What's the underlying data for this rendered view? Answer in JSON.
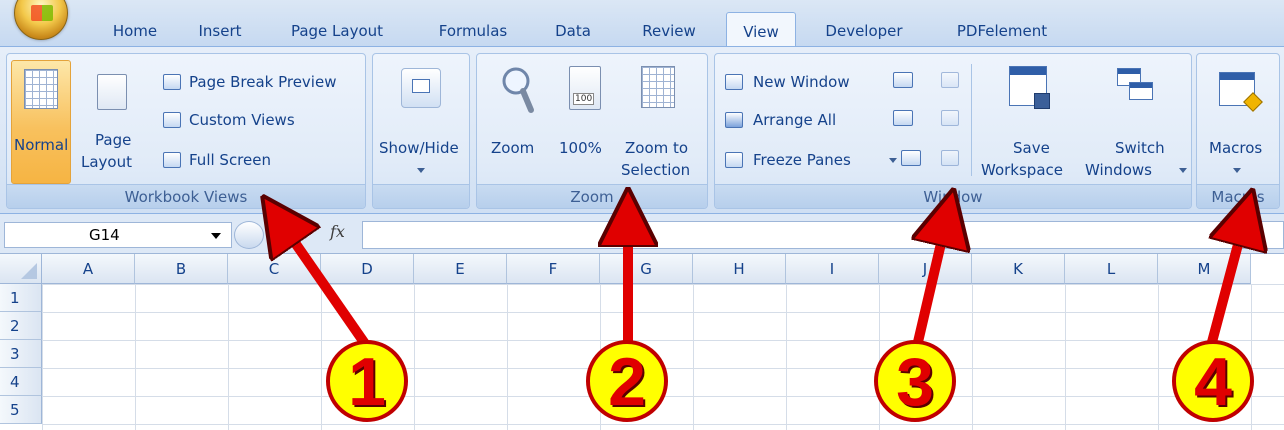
{
  "tabs": [
    {
      "label": "Home",
      "active": false
    },
    {
      "label": "Insert",
      "active": false
    },
    {
      "label": "Page Layout",
      "active": false
    },
    {
      "label": "Formulas",
      "active": false
    },
    {
      "label": "Data",
      "active": false
    },
    {
      "label": "Review",
      "active": false
    },
    {
      "label": "View",
      "active": true
    },
    {
      "label": "Developer",
      "active": false
    },
    {
      "label": "PDFelement",
      "active": false
    }
  ],
  "groups": {
    "workbook_views": {
      "title": "Workbook Views",
      "normal": "Normal",
      "page_layout_1": "Page",
      "page_layout_2": "Layout",
      "page_break_preview": "Page Break Preview",
      "custom_views": "Custom Views",
      "full_screen": "Full Screen"
    },
    "show_hide": {
      "title": "",
      "label": "Show/Hide"
    },
    "zoom": {
      "title": "Zoom",
      "zoom": "Zoom",
      "hundred": "100%",
      "hundred_icon": "100",
      "zoom_to_1": "Zoom to",
      "zoom_to_2": "Selection"
    },
    "window": {
      "title": "Window",
      "new_window": "New Window",
      "arrange_all": "Arrange All",
      "freeze_panes": "Freeze Panes",
      "save_1": "Save",
      "save_2": "Workspace",
      "switch_1": "Switch",
      "switch_2": "Windows"
    },
    "macros": {
      "title": "Macros",
      "label": "Macros"
    }
  },
  "formula_bar": {
    "name_box": "G14",
    "fx": "fx",
    "formula": ""
  },
  "sheet": {
    "columns": [
      "A",
      "B",
      "C",
      "D",
      "E",
      "F",
      "G",
      "H",
      "I",
      "J",
      "K",
      "L",
      "M"
    ],
    "rows": [
      "1",
      "2",
      "3",
      "4",
      "5"
    ]
  },
  "annotations": [
    "1",
    "2",
    "3",
    "4"
  ],
  "colors": {
    "arrow": "#e00000",
    "badge_fill": "#ffff00",
    "ribbon_text": "#15428b",
    "normal_highlight": "#f8c15e"
  }
}
